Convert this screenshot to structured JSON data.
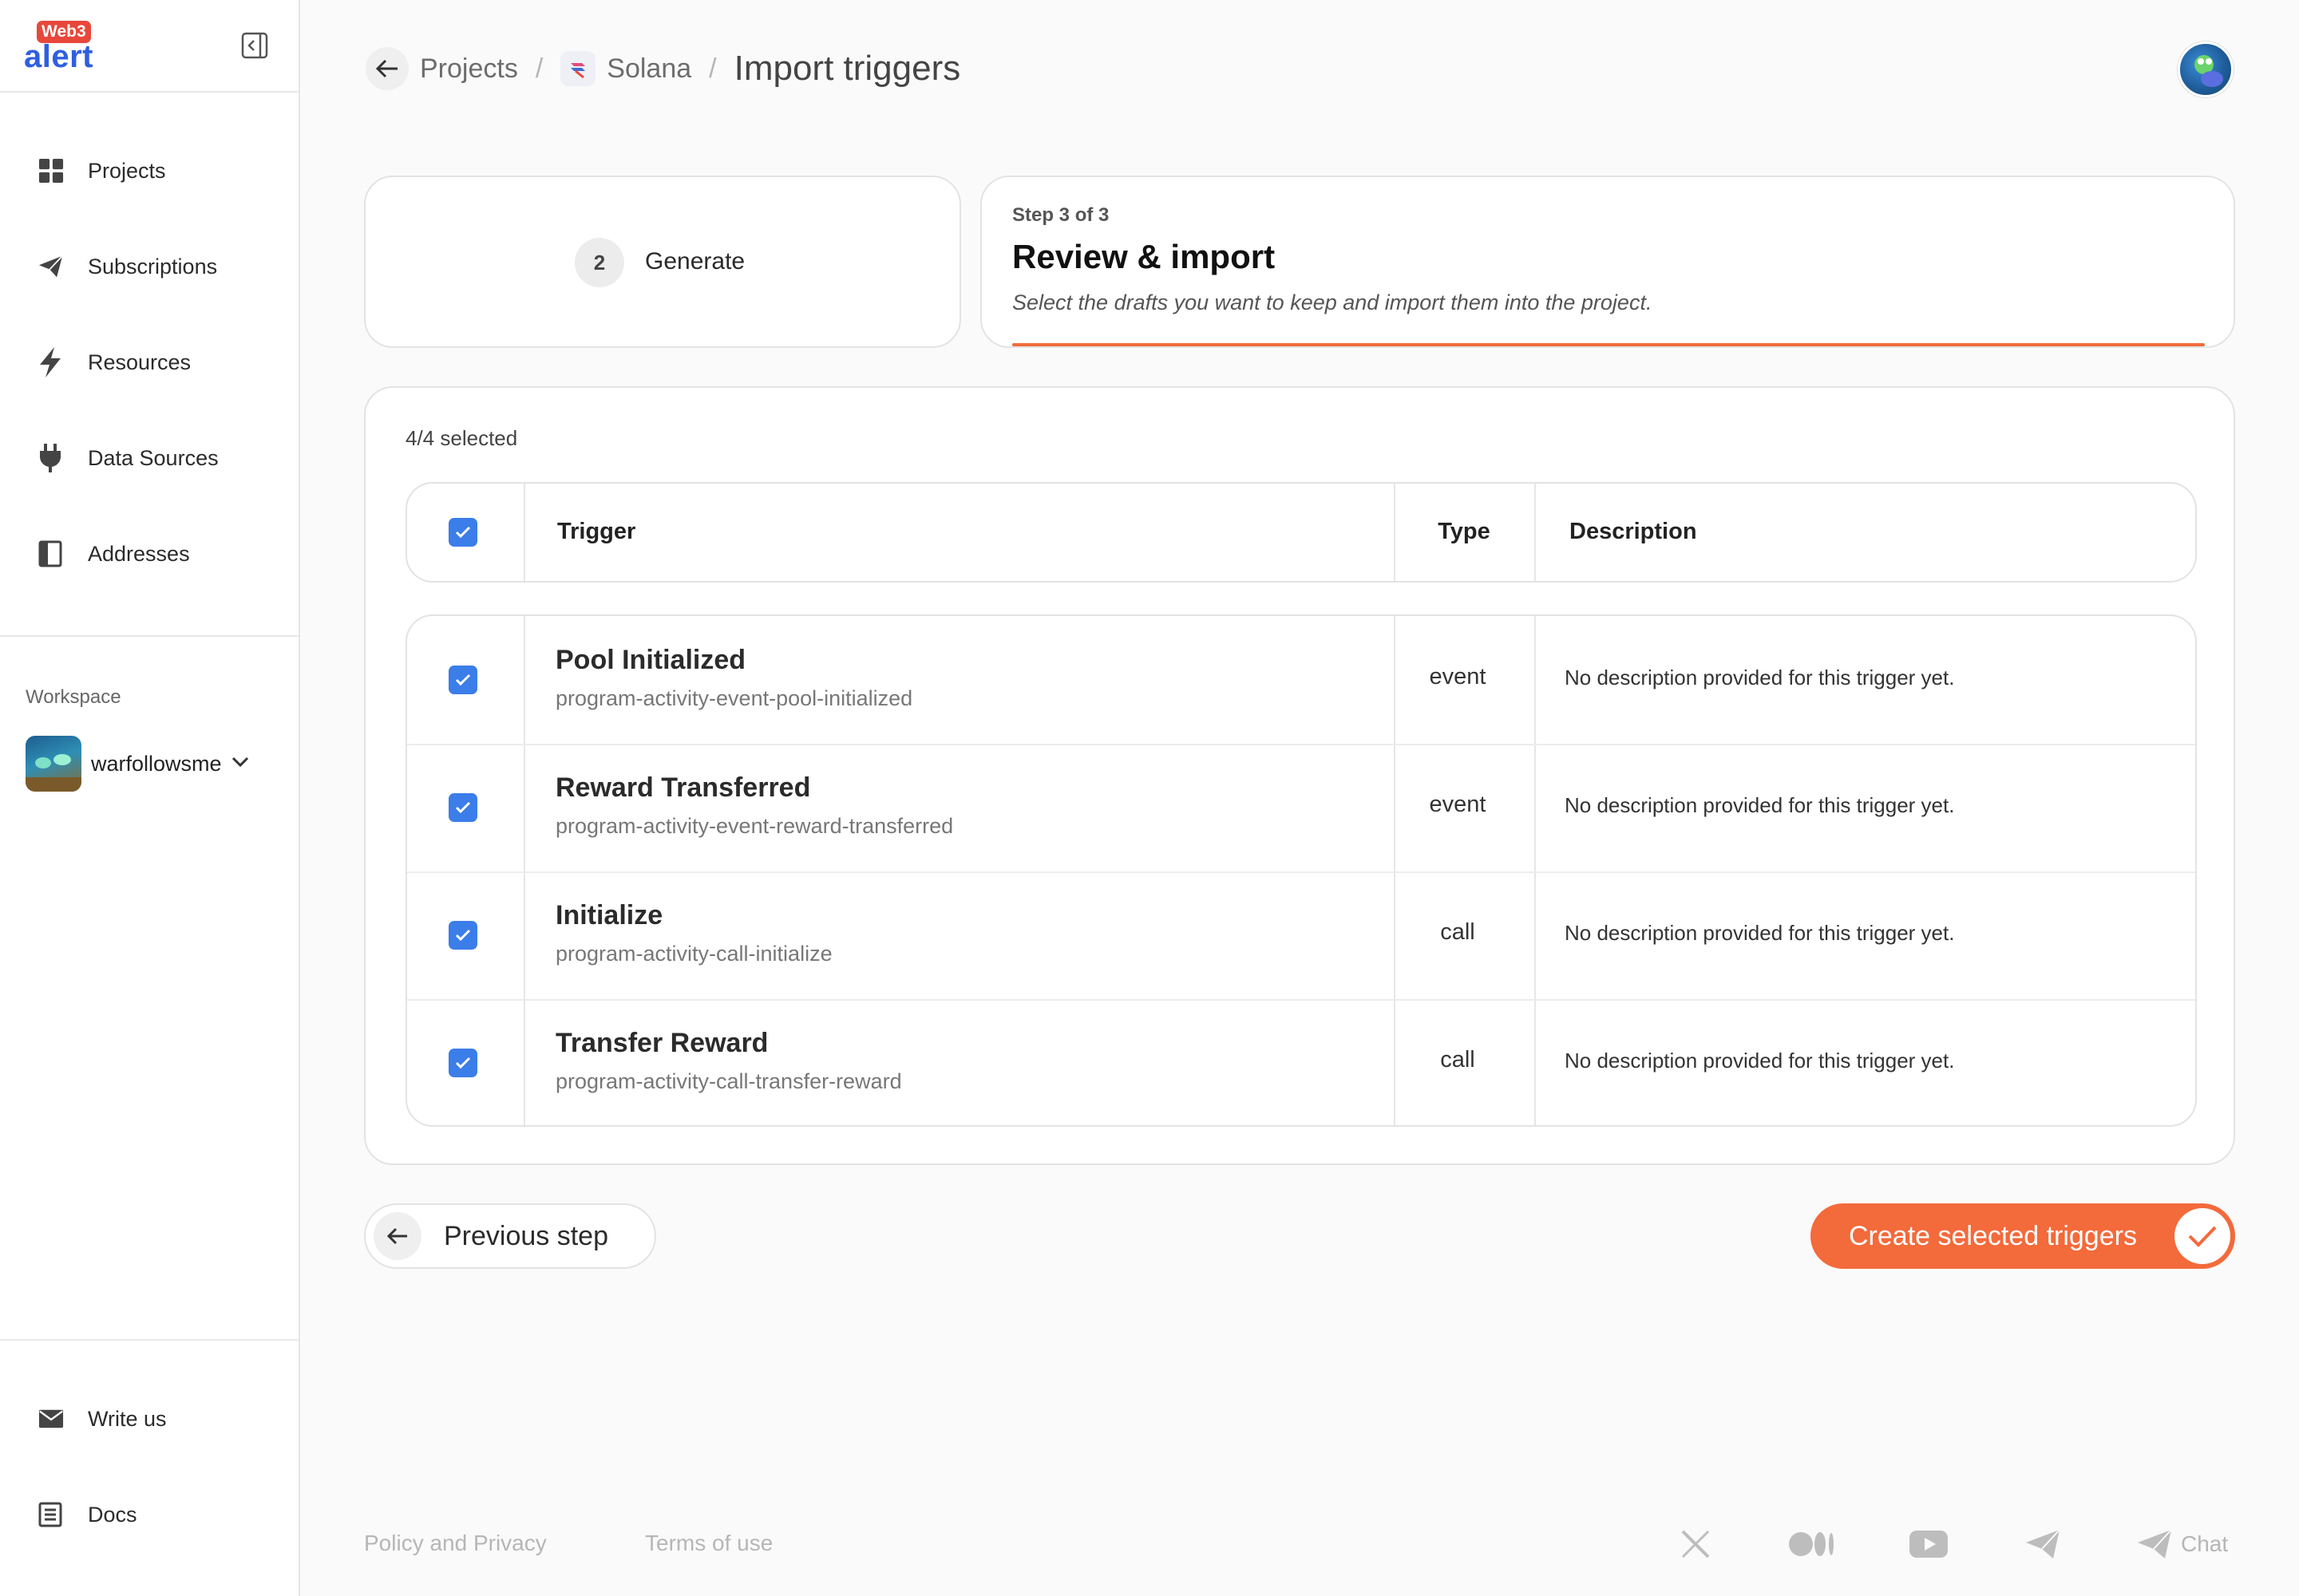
{
  "brand": {
    "badge": "Web3",
    "word": "alert"
  },
  "sidebar": {
    "items": [
      {
        "label": "Projects",
        "icon": "grid-icon"
      },
      {
        "label": "Subscriptions",
        "icon": "send-icon"
      },
      {
        "label": "Resources",
        "icon": "bolt-icon"
      },
      {
        "label": "Data Sources",
        "icon": "plug-icon"
      },
      {
        "label": "Addresses",
        "icon": "book-icon"
      }
    ],
    "workspace_title": "Workspace",
    "workspace_name": "warfollowsme",
    "bottom_items": [
      {
        "label": "Write us",
        "icon": "mail-icon"
      },
      {
        "label": "Docs",
        "icon": "doc-icon"
      }
    ]
  },
  "header": {
    "crumb_projects": "Projects",
    "crumb_project": "Solana",
    "crumb_sep": "/",
    "current": "Import triggers"
  },
  "steps": {
    "generate": {
      "number": "2",
      "label": "Generate"
    },
    "review": {
      "small": "Step 3 of 3",
      "title": "Review & import",
      "subtitle": "Select the drafts you want to keep and import them into the project."
    }
  },
  "table": {
    "selected_count": "4/4 selected",
    "headers": {
      "trigger": "Trigger",
      "type": "Type",
      "description": "Description"
    },
    "rows": [
      {
        "name": "Pool Initialized",
        "slug": "program-activity-event-pool-initialized",
        "type": "event",
        "description": "No description provided for this trigger yet.",
        "checked": true
      },
      {
        "name": "Reward Transferred",
        "slug": "program-activity-event-reward-transferred",
        "type": "event",
        "description": "No description provided for this trigger yet.",
        "checked": true
      },
      {
        "name": "Initialize",
        "slug": "program-activity-call-initialize",
        "type": "call",
        "description": "No description provided for this trigger yet.",
        "checked": true
      },
      {
        "name": "Transfer Reward",
        "slug": "program-activity-call-transfer-reward",
        "type": "call",
        "description": "No description provided for this trigger yet.",
        "checked": true
      }
    ]
  },
  "actions": {
    "previous": "Previous step",
    "create": "Create selected triggers"
  },
  "footer": {
    "policy": "Policy and Privacy",
    "terms": "Terms of use",
    "socials": [
      "x-icon",
      "medium-icon",
      "youtube-icon",
      "telegram-icon"
    ],
    "chat": "Chat"
  },
  "colors": {
    "accent": "#f36a3b",
    "checkbox": "#3b7de9",
    "brand_blue": "#2f5fe0",
    "brand_red": "#e8473b"
  }
}
